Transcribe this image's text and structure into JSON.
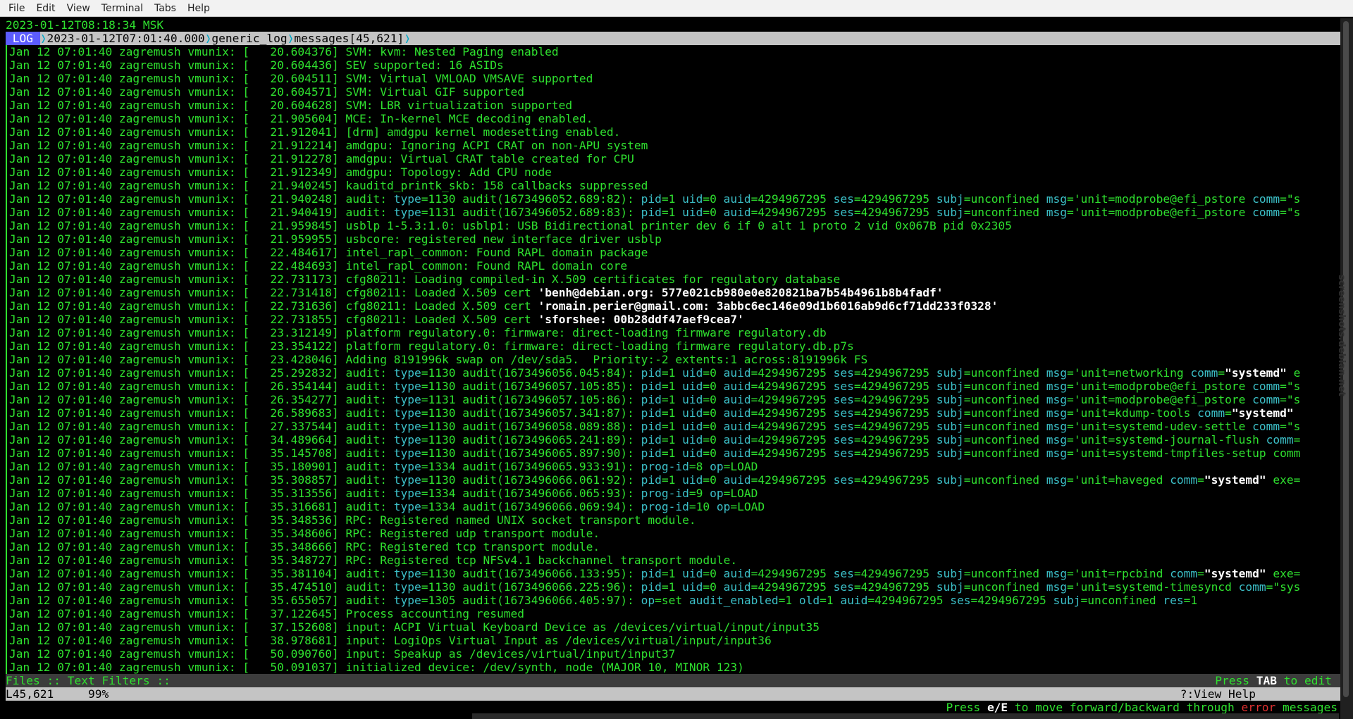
{
  "menubar": {
    "items": [
      "File",
      "Edit",
      "View",
      "Terminal",
      "Tabs",
      "Help"
    ]
  },
  "header": {
    "clock": "2023-01-12T08:18:34 MSK",
    "tag": "LOG",
    "timestamp": "2023-01-12T07:01:40.000",
    "format": "generic_log",
    "file": "messages[45,621]"
  },
  "watermark": "screenshots.debian.net",
  "log_lines": [
    {
      "prefix": "Jan 12 07:01:40 zagremush vmunix: [",
      "ts": "   20.604376]",
      "msg": " SVM: kvm: Nested Paging enabled"
    },
    {
      "prefix": "Jan 12 07:01:40 zagremush vmunix: [",
      "ts": "   20.604436]",
      "msg": " SEV supported: 16 ASIDs"
    },
    {
      "prefix": "Jan 12 07:01:40 zagremush vmunix: [",
      "ts": "   20.604511]",
      "msg": " SVM: Virtual VMLOAD VMSAVE supported"
    },
    {
      "prefix": "Jan 12 07:01:40 zagremush vmunix: [",
      "ts": "   20.604571]",
      "msg": " SVM: Virtual GIF supported"
    },
    {
      "prefix": "Jan 12 07:01:40 zagremush vmunix: [",
      "ts": "   20.604628]",
      "msg": " SVM: LBR virtualization supported"
    },
    {
      "prefix": "Jan 12 07:01:40 zagremush vmunix: [",
      "ts": "   21.905604]",
      "msg": " MCE: In-kernel MCE decoding enabled."
    },
    {
      "prefix": "Jan 12 07:01:40 zagremush vmunix: [",
      "ts": "   21.912041]",
      "msg": " [drm] amdgpu kernel modesetting enabled."
    },
    {
      "prefix": "Jan 12 07:01:40 zagremush vmunix: [",
      "ts": "   21.912214]",
      "msg": " amdgpu: Ignoring ACPI CRAT on non-APU system"
    },
    {
      "prefix": "Jan 12 07:01:40 zagremush vmunix: [",
      "ts": "   21.912278]",
      "msg": " amdgpu: Virtual CRAT table created for CPU"
    },
    {
      "prefix": "Jan 12 07:01:40 zagremush vmunix: [",
      "ts": "   21.912349]",
      "msg": " amdgpu: Topology: Add CPU node"
    },
    {
      "prefix": "Jan 12 07:01:40 zagremush vmunix: [",
      "ts": "   21.940245]",
      "msg": " kauditd_printk_skb: 158 callbacks suppressed"
    },
    {
      "prefix": "Jan 12 07:01:40 zagremush vmunix: [",
      "ts": "   21.940248]",
      "audit": {
        "type": "1130",
        "id": "(1673496052.689:82):",
        "rest": " pid=1 uid=0 auid=4294967295 ses=4294967295 subj=unconfined msg='unit=modprobe@efi_pstore comm=\"s"
      }
    },
    {
      "prefix": "Jan 12 07:01:40 zagremush vmunix: [",
      "ts": "   21.940419]",
      "audit": {
        "type": "1131",
        "id": "(1673496052.689:83):",
        "rest": " pid=1 uid=0 auid=4294967295 ses=4294967295 subj=unconfined msg='unit=modprobe@efi_pstore comm=\"s"
      }
    },
    {
      "prefix": "Jan 12 07:01:40 zagremush vmunix: [",
      "ts": "   21.959845]",
      "msg": " usblp 1-5.3:1.0: usblp1: USB Bidirectional printer dev 6 if 0 alt 1 proto 2 vid 0x067B pid 0x2305"
    },
    {
      "prefix": "Jan 12 07:01:40 zagremush vmunix: [",
      "ts": "   21.959955]",
      "msg": " usbcore: registered new interface driver usblp"
    },
    {
      "prefix": "Jan 12 07:01:40 zagremush vmunix: [",
      "ts": "   22.484617]",
      "msg": " intel_rapl_common: Found RAPL domain package"
    },
    {
      "prefix": "Jan 12 07:01:40 zagremush vmunix: [",
      "ts": "   22.484693]",
      "msg": " intel_rapl_common: Found RAPL domain core"
    },
    {
      "prefix": "Jan 12 07:01:40 zagremush vmunix: [",
      "ts": "   22.731173]",
      "msg": " cfg80211: Loading compiled-in X.509 certificates for regulatory database"
    },
    {
      "prefix": "Jan 12 07:01:40 zagremush vmunix: [",
      "ts": "   22.731418]",
      "msg": " cfg80211: Loaded X.509 cert ",
      "bold": "'benh@debian.org: 577e021cb980e0e820821ba7b54b4961b8b4fadf'"
    },
    {
      "prefix": "Jan 12 07:01:40 zagremush vmunix: [",
      "ts": "   22.731636]",
      "msg": " cfg80211: Loaded X.509 cert ",
      "bold": "'romain.perier@gmail.com: 3abbc6ec146e09d1b6016ab9d6cf71dd233f0328'"
    },
    {
      "prefix": "Jan 12 07:01:40 zagremush vmunix: [",
      "ts": "   22.731855]",
      "msg": " cfg80211: Loaded X.509 cert ",
      "bold": "'sforshee: 00b28ddf47aef9cea7'"
    },
    {
      "prefix": "Jan 12 07:01:40 zagremush vmunix: [",
      "ts": "   23.312149]",
      "msg": " platform regulatory.0: firmware: direct-loading firmware regulatory.db"
    },
    {
      "prefix": "Jan 12 07:01:40 zagremush vmunix: [",
      "ts": "   23.354122]",
      "msg": " platform regulatory.0: firmware: direct-loading firmware regulatory.db.p7s"
    },
    {
      "prefix": "Jan 12 07:01:40 zagremush vmunix: [",
      "ts": "   23.428046]",
      "msg": " Adding 8191996k swap on /dev/sda5.  Priority:-2 extents:1 across:8191996k FS"
    },
    {
      "prefix": "Jan 12 07:01:40 zagremush vmunix: [",
      "ts": "   25.292832]",
      "audit": {
        "type": "1130",
        "id": "(1673496056.045:84):",
        "rest": " pid=1 uid=0 auid=4294967295 ses=4294967295 subj=unconfined msg='unit=networking comm=",
        "tailb": "\"systemd\"",
        "tail": " e"
      }
    },
    {
      "prefix": "Jan 12 07:01:40 zagremush vmunix: [",
      "ts": "   26.354144]",
      "audit": {
        "type": "1130",
        "id": "(1673496057.105:85):",
        "rest": " pid=1 uid=0 auid=4294967295 ses=4294967295 subj=unconfined msg='unit=modprobe@efi_pstore comm=\"s"
      }
    },
    {
      "prefix": "Jan 12 07:01:40 zagremush vmunix: [",
      "ts": "   26.354277]",
      "audit": {
        "type": "1131",
        "id": "(1673496057.105:86):",
        "rest": " pid=1 uid=0 auid=4294967295 ses=4294967295 subj=unconfined msg='unit=modprobe@efi_pstore comm=\"s"
      }
    },
    {
      "prefix": "Jan 12 07:01:40 zagremush vmunix: [",
      "ts": "   26.589683]",
      "audit": {
        "type": "1130",
        "id": "(1673496057.341:87):",
        "rest": " pid=1 uid=0 auid=4294967295 ses=4294967295 subj=unconfined msg='unit=kdump-tools comm=",
        "tailb": "\"systemd\"",
        "tail": ""
      }
    },
    {
      "prefix": "Jan 12 07:01:40 zagremush vmunix: [",
      "ts": "   27.337544]",
      "audit": {
        "type": "1130",
        "id": "(1673496058.089:88):",
        "rest": " pid=1 uid=0 auid=4294967295 ses=4294967295 subj=unconfined msg='unit=systemd-udev-settle comm=\"s"
      }
    },
    {
      "prefix": "Jan 12 07:01:40 zagremush vmunix: [",
      "ts": "   34.489664]",
      "audit": {
        "type": "1130",
        "id": "(1673496065.241:89):",
        "rest": " pid=1 uid=0 auid=4294967295 ses=4294967295 subj=unconfined msg='unit=systemd-journal-flush comm="
      }
    },
    {
      "prefix": "Jan 12 07:01:40 zagremush vmunix: [",
      "ts": "   35.145708]",
      "audit": {
        "type": "1130",
        "id": "(1673496065.897:90):",
        "rest": " pid=1 uid=0 auid=4294967295 ses=4294967295 subj=unconfined msg='unit=systemd-tmpfiles-setup comm"
      }
    },
    {
      "prefix": "Jan 12 07:01:40 zagremush vmunix: [",
      "ts": "   35.180901]",
      "audit": {
        "type": "1334",
        "id": "(1673496065.933:91):",
        "rest": " prog-id=8 op=LOAD"
      }
    },
    {
      "prefix": "Jan 12 07:01:40 zagremush vmunix: [",
      "ts": "   35.308857]",
      "audit": {
        "type": "1130",
        "id": "(1673496066.061:92):",
        "rest": " pid=1 uid=0 auid=4294967295 ses=4294967295 subj=unconfined msg='unit=haveged comm=",
        "tailb": "\"systemd\"",
        "tail": " exe="
      }
    },
    {
      "prefix": "Jan 12 07:01:40 zagremush vmunix: [",
      "ts": "   35.313556]",
      "audit": {
        "type": "1334",
        "id": "(1673496066.065:93):",
        "rest": " prog-id=9 op=LOAD"
      }
    },
    {
      "prefix": "Jan 12 07:01:40 zagremush vmunix: [",
      "ts": "   35.316681]",
      "audit": {
        "type": "1334",
        "id": "(1673496066.069:94):",
        "rest": " prog-id=10 op=LOAD"
      }
    },
    {
      "prefix": "Jan 12 07:01:40 zagremush vmunix: [",
      "ts": "   35.348536]",
      "msg": " RPC: Registered named UNIX socket transport module."
    },
    {
      "prefix": "Jan 12 07:01:40 zagremush vmunix: [",
      "ts": "   35.348606]",
      "msg": " RPC: Registered udp transport module."
    },
    {
      "prefix": "Jan 12 07:01:40 zagremush vmunix: [",
      "ts": "   35.348666]",
      "msg": " RPC: Registered tcp transport module."
    },
    {
      "prefix": "Jan 12 07:01:40 zagremush vmunix: [",
      "ts": "   35.348727]",
      "msg": " RPC: Registered tcp NFSv4.1 backchannel transport module."
    },
    {
      "prefix": "Jan 12 07:01:40 zagremush vmunix: [",
      "ts": "   35.381104]",
      "audit": {
        "type": "1130",
        "id": "(1673496066.133:95):",
        "rest": " pid=1 uid=0 auid=4294967295 ses=4294967295 subj=unconfined msg='unit=rpcbind comm=",
        "tailb": "\"systemd\"",
        "tail": " exe="
      }
    },
    {
      "prefix": "Jan 12 07:01:40 zagremush vmunix: [",
      "ts": "   35.474510]",
      "audit": {
        "type": "1130",
        "id": "(1673496066.225:96):",
        "rest": " pid=1 uid=0 auid=4294967295 ses=4294967295 subj=unconfined msg='unit=systemd-timesyncd comm=\"sys"
      }
    },
    {
      "prefix": "Jan 12 07:01:40 zagremush vmunix: [",
      "ts": "   35.655057]",
      "audit": {
        "type": "1305",
        "id": "(1673496066.405:97):",
        "rest": " op=set audit_enabled=1 old=1 auid=4294967295 ses=4294967295 subj=unconfined res=1"
      }
    },
    {
      "prefix": "Jan 12 07:01:40 zagremush vmunix: [",
      "ts": "   37.122645]",
      "msg": " Process accounting resumed"
    },
    {
      "prefix": "Jan 12 07:01:40 zagremush vmunix: [",
      "ts": "   37.152608]",
      "msg": " input: ACPI Virtual Keyboard Device as /devices/virtual/input/input35"
    },
    {
      "prefix": "Jan 12 07:01:40 zagremush vmunix: [",
      "ts": "   38.978681]",
      "msg": " input: LogiOps Virtual Input as /devices/virtual/input/input36"
    },
    {
      "prefix": "Jan 12 07:01:40 zagremush vmunix: [",
      "ts": "   50.090760]",
      "msg": " input: Speakup as /devices/virtual/input/input37"
    },
    {
      "prefix": "Jan 12 07:01:40 zagremush vmunix: [",
      "ts": "   50.091037]",
      "msg": " initialized device: /dev/synth, node (MAJOR 10, MINOR 123)"
    }
  ],
  "filters_bar": {
    "left": "Files :: Text Filters ::",
    "press": "Press ",
    "key": "TAB",
    "suffix": " to edit"
  },
  "status": {
    "position": "L45,621",
    "percent": "99%",
    "help": "?:View Help"
  },
  "hint": {
    "press": "Press ",
    "keys": "e/E",
    "middle": " to move forward/backward through ",
    "err": "error",
    "end": " messages"
  },
  "colors": {
    "log_text": "#2fe12f",
    "audit_key": "#3cc0c8",
    "breadcrumb_tag": "#5c5cff",
    "error": "#e03030"
  }
}
